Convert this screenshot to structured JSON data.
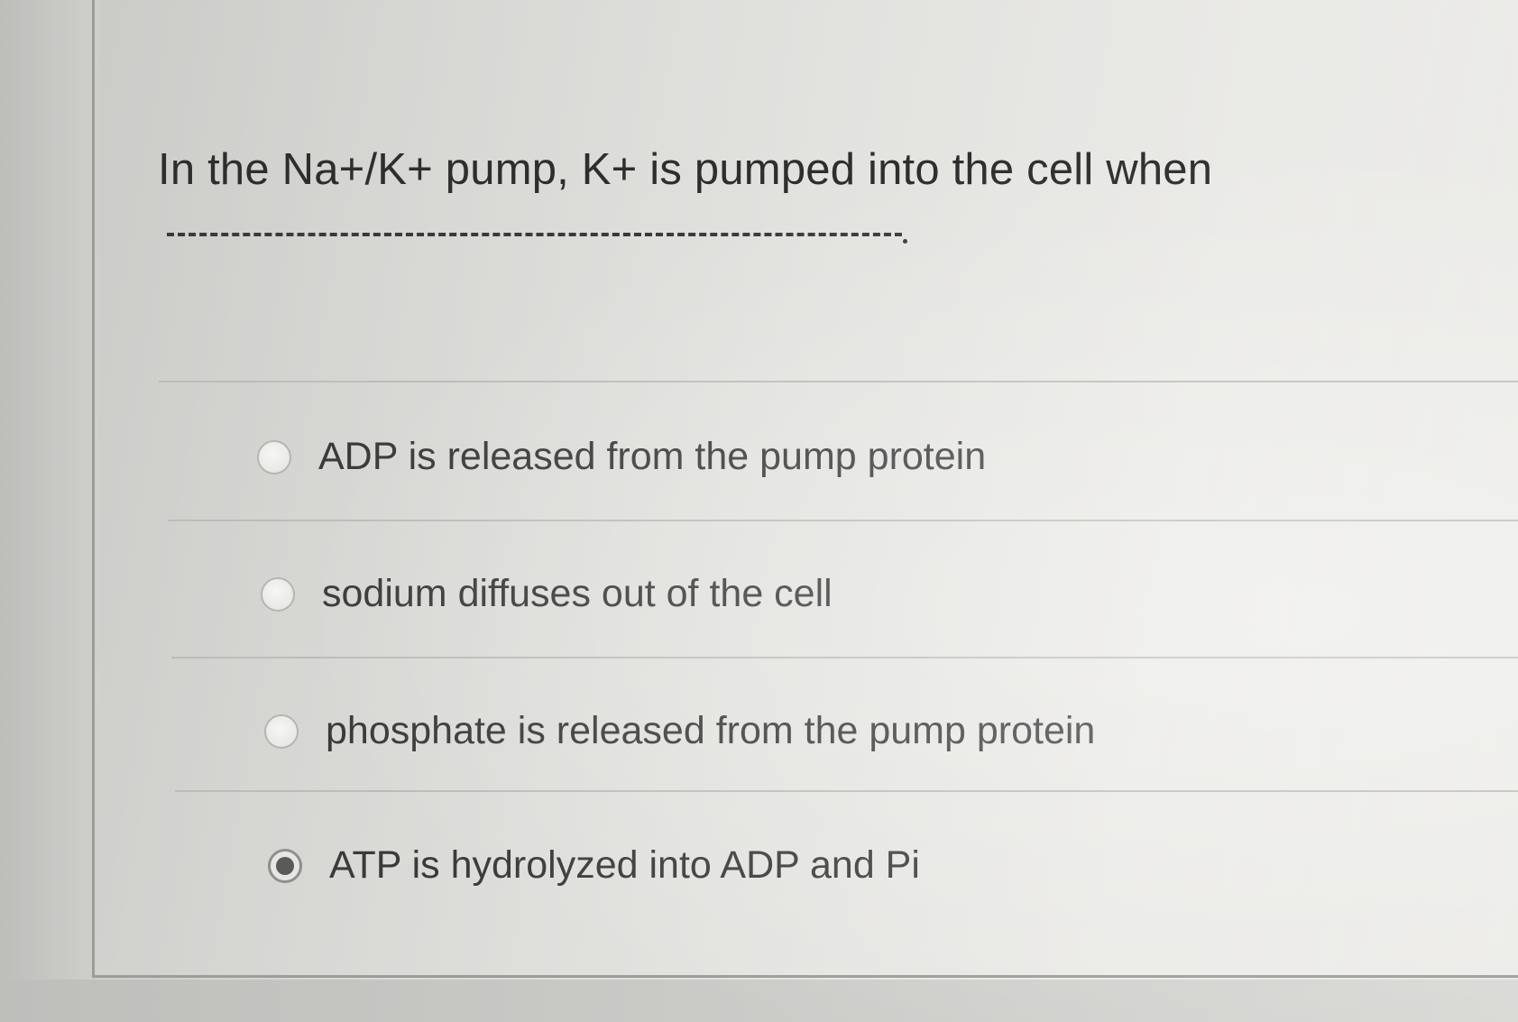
{
  "question": {
    "text": "In the Na+/K+ pump, K+ is pumped into the cell when",
    "blank_suffix": "."
  },
  "options": [
    {
      "label": "ADP is released from the pump protein",
      "selected": false
    },
    {
      "label": "sodium diffuses out of the cell",
      "selected": false
    },
    {
      "label": "phosphate is released from the pump protein",
      "selected": false
    },
    {
      "label": "ATP is hydrolyzed into ADP and Pi",
      "selected": true
    }
  ],
  "colors": {
    "text": "#2e2e2e",
    "radio_selected": "#5a5a58",
    "divider": "#bcbcb9"
  }
}
